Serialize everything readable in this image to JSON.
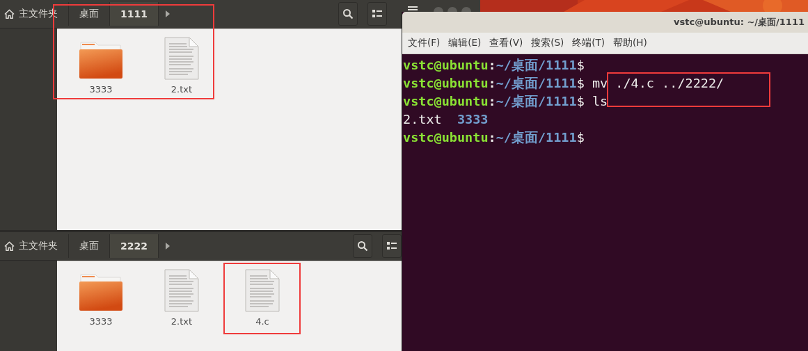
{
  "file_managers": [
    {
      "breadcrumbs": [
        {
          "label": "主文件夹",
          "kind": "home",
          "selected": false
        },
        {
          "label": "桌面",
          "kind": "dir",
          "selected": false
        },
        {
          "label": "1111",
          "kind": "dir",
          "selected": true
        }
      ],
      "items": [
        {
          "name": "3333",
          "kind": "folder"
        },
        {
          "name": "2.txt",
          "kind": "text"
        }
      ]
    },
    {
      "breadcrumbs": [
        {
          "label": "主文件夹",
          "kind": "home",
          "selected": false
        },
        {
          "label": "桌面",
          "kind": "dir",
          "selected": false
        },
        {
          "label": "2222",
          "kind": "dir",
          "selected": true
        }
      ],
      "items": [
        {
          "name": "3333",
          "kind": "folder"
        },
        {
          "name": "2.txt",
          "kind": "text"
        },
        {
          "name": "4.c",
          "kind": "text"
        }
      ]
    }
  ],
  "terminal": {
    "title": "vstc@ubuntu: ~/桌面/1111",
    "menu": [
      "文件(F)",
      "编辑(E)",
      "查看(V)",
      "搜索(S)",
      "终端(T)",
      "帮助(H)"
    ],
    "lines": [
      {
        "kind": "prompt",
        "user": "vstc@ubuntu",
        "separator": ":",
        "path": "~/桌面/1111",
        "sign": "$"
      },
      {
        "kind": "prompt",
        "user": "vstc@ubuntu",
        "separator": ":",
        "path": "~/桌面/1111",
        "sign": "$",
        "command": "mv ./4.c ../2222/"
      },
      {
        "kind": "prompt",
        "user": "vstc@ubuntu",
        "separator": ":",
        "path": "~/桌面/1111",
        "sign": "$",
        "command": "ls"
      },
      {
        "kind": "output",
        "entries": [
          {
            "text": "2.txt",
            "kind": "file"
          },
          {
            "text": "3333",
            "kind": "dir"
          }
        ]
      },
      {
        "kind": "prompt",
        "user": "vstc@ubuntu",
        "separator": ":",
        "path": "~/桌面/1111",
        "sign": "$"
      }
    ]
  }
}
